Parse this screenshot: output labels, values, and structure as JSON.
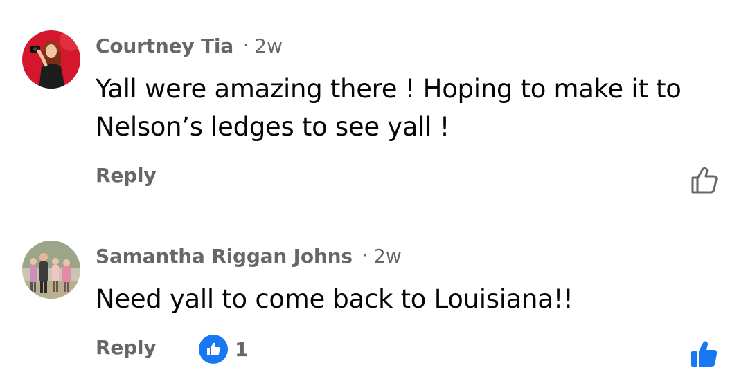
{
  "comments": [
    {
      "author": "Courtney Tia",
      "separator": "·",
      "time": "2w",
      "text": "Yall were amazing there ! Hoping to make it to Nelson’s ledges to see yall !",
      "reply_label": "Reply",
      "liked": false,
      "avatar_icon": "profile-photo-red-background"
    },
    {
      "author": "Samantha Riggan Johns",
      "separator": "·",
      "time": "2w",
      "text": "Need yall to come back to Louisiana!!",
      "reply_label": "Reply",
      "reaction_icon": "like-reaction-icon",
      "reaction_count": "1",
      "liked": true,
      "avatar_icon": "profile-photo-family-group"
    }
  ],
  "colors": {
    "secondary_text": "#65676b",
    "primary_text": "#050505",
    "accent_blue": "#1877f2"
  }
}
